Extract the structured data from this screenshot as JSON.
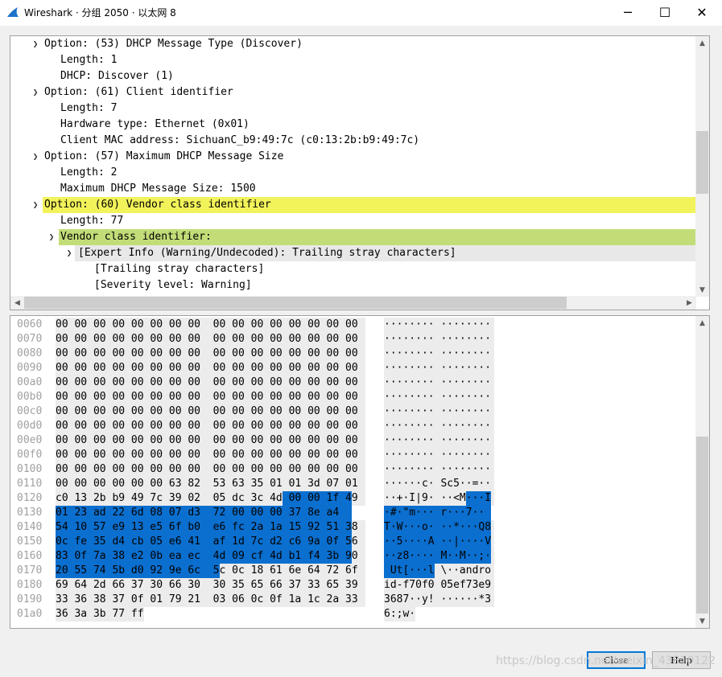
{
  "window": {
    "title": "Wireshark · 分组 2050 · 以太网 8",
    "icon": "wireshark-fin-icon",
    "controls": {
      "minimize": "─",
      "maximize": "☐",
      "close": "✕"
    }
  },
  "tree": {
    "items": [
      {
        "text": "Option: (53) DHCP Message Type (Discover)",
        "expanded": true,
        "depth": 1
      },
      {
        "text": "Length: 1",
        "depth": 2
      },
      {
        "text": "DHCP: Discover (1)",
        "depth": 2
      },
      {
        "text": "Option: (61) Client identifier",
        "expanded": true,
        "depth": 1
      },
      {
        "text": "Length: 7",
        "depth": 2
      },
      {
        "text": "Hardware type: Ethernet (0x01)",
        "depth": 2
      },
      {
        "text": "Client MAC address: SichuanC_b9:49:7c (c0:13:2b:b9:49:7c)",
        "depth": 2
      },
      {
        "text": "Option: (57) Maximum DHCP Message Size",
        "expanded": true,
        "depth": 1
      },
      {
        "text": "Length: 2",
        "depth": 2
      },
      {
        "text": "Maximum DHCP Message Size: 1500",
        "depth": 2
      },
      {
        "text": "Option: (60) Vendor class identifier",
        "expanded": true,
        "depth": 1,
        "highlight": "#f2f25a"
      },
      {
        "text": "Length: 77",
        "depth": 2
      },
      {
        "text": "Vendor class identifier:",
        "expanded": true,
        "depth": 2,
        "highlight": "#c2dd78"
      },
      {
        "text": "[Expert Info (Warning/Undecoded): Trailing stray characters]",
        "expanded": true,
        "depth": 3,
        "highlight": "#e8e8e8"
      },
      {
        "text": "[Trailing stray characters]",
        "depth": 4
      },
      {
        "text": "[Severity level: Warning]",
        "depth": 4
      }
    ]
  },
  "hex": {
    "rows": [
      {
        "offset": "0060",
        "bytes": "00 00 00 00 00 00 00 00  00 00 00 00 00 00 00 00",
        "ascii": "········ ········"
      },
      {
        "offset": "0070",
        "bytes": "00 00 00 00 00 00 00 00  00 00 00 00 00 00 00 00",
        "ascii": "········ ········"
      },
      {
        "offset": "0080",
        "bytes": "00 00 00 00 00 00 00 00  00 00 00 00 00 00 00 00",
        "ascii": "········ ········"
      },
      {
        "offset": "0090",
        "bytes": "00 00 00 00 00 00 00 00  00 00 00 00 00 00 00 00",
        "ascii": "········ ········"
      },
      {
        "offset": "00a0",
        "bytes": "00 00 00 00 00 00 00 00  00 00 00 00 00 00 00 00",
        "ascii": "········ ········"
      },
      {
        "offset": "00b0",
        "bytes": "00 00 00 00 00 00 00 00  00 00 00 00 00 00 00 00",
        "ascii": "········ ········"
      },
      {
        "offset": "00c0",
        "bytes": "00 00 00 00 00 00 00 00  00 00 00 00 00 00 00 00",
        "ascii": "········ ········"
      },
      {
        "offset": "00d0",
        "bytes": "00 00 00 00 00 00 00 00  00 00 00 00 00 00 00 00",
        "ascii": "········ ········"
      },
      {
        "offset": "00e0",
        "bytes": "00 00 00 00 00 00 00 00  00 00 00 00 00 00 00 00",
        "ascii": "········ ········"
      },
      {
        "offset": "00f0",
        "bytes": "00 00 00 00 00 00 00 00  00 00 00 00 00 00 00 00",
        "ascii": "········ ········"
      },
      {
        "offset": "0100",
        "bytes": "00 00 00 00 00 00 00 00  00 00 00 00 00 00 00 00",
        "ascii": "········ ········"
      },
      {
        "offset": "0110",
        "bytes": "00 00 00 00 00 00 63 82  53 63 35 01 01 3d 07 01",
        "ascii": "······c· Sc5··=··"
      },
      {
        "offset": "0120",
        "bytes": "c0 13 2b b9 49 7c 39 02  05 dc 3c 4d 00 00 1f 49",
        "ascii": "··+·I|9· ··<M···I"
      },
      {
        "offset": "0130",
        "bytes": "01 23 ad 22 6d 08 07 d3  72 00 00 00 37 8e a4",
        "ascii": "·#·\"m··· r···7··"
      },
      {
        "offset": "0140",
        "bytes": "54 10 57 e9 13 e5 6f b0  e6 fc 2a 1a 15 92 51 38",
        "ascii": "T·W···o· ··*···Q8"
      },
      {
        "offset": "0150",
        "bytes": "0c fe 35 d4 cb 05 e6 41  af 1d 7c d2 c6 9a 0f 56",
        "ascii": "··5····A ··|····V"
      },
      {
        "offset": "0160",
        "bytes": "83 0f 7a 38 e2 0b ea ec  4d 09 cf 4d b1 f4 3b 90",
        "ascii": "··z8···· M··M··;·"
      },
      {
        "offset": "0170",
        "bytes": "20 55 74 5b d0 92 9e 6c  5c 0c 18 61 6e 64 72 6f",
        "ascii": " Ut[···l \\··andro"
      },
      {
        "offset": "0180",
        "bytes": "69 64 2d 66 37 30 66 30  30 35 65 66 37 33 65 39",
        "ascii": "id-f70f0 05ef73e9"
      },
      {
        "offset": "0190",
        "bytes": "33 36 38 37 0f 01 79 21  03 06 0c 0f 1a 1c 2a 33",
        "ascii": "3687··y! ······*3"
      },
      {
        "offset": "01a0",
        "bytes": "36 3a 3b 77 ff",
        "ascii": "6:;w·"
      }
    ]
  },
  "buttons": {
    "close": "Close",
    "help": "Help"
  },
  "watermark": "https://blog.csdn.net/weixin_43810122",
  "colors": {
    "selection": "#0b6fcf",
    "tree_yellow": "#f2f25a",
    "tree_green": "#c2dd78"
  }
}
